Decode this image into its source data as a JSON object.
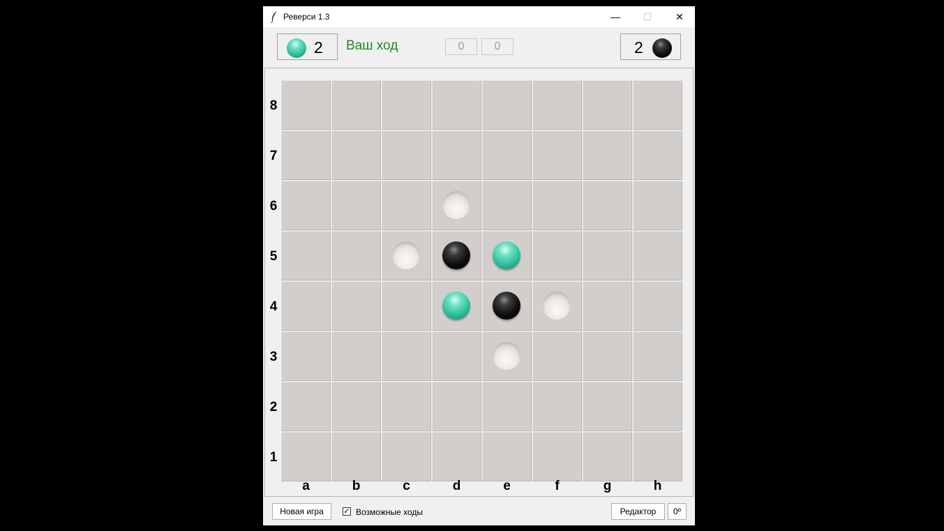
{
  "window": {
    "title": "Реверси 1.3",
    "controls": {
      "minimize": "—",
      "maximize": "☐",
      "close": "✕"
    }
  },
  "header": {
    "player_score": "2",
    "player_color": "teal",
    "turn_text": "Ваш ход",
    "counter_1": "0",
    "counter_2": "0",
    "opponent_score": "2",
    "opponent_color": "black"
  },
  "board": {
    "files": [
      "a",
      "b",
      "c",
      "d",
      "e",
      "f",
      "g",
      "h"
    ],
    "ranks": [
      "8",
      "7",
      "6",
      "5",
      "4",
      "3",
      "2",
      "1"
    ],
    "pieces": [
      {
        "square": "d5",
        "color": "black"
      },
      {
        "square": "e5",
        "color": "teal"
      },
      {
        "square": "d4",
        "color": "teal"
      },
      {
        "square": "e4",
        "color": "black"
      }
    ],
    "hints": [
      "d6",
      "c5",
      "f4",
      "e3"
    ]
  },
  "footer": {
    "new_game_label": "Новая игра",
    "possible_moves_label": "Возможные ходы",
    "possible_moves_checked": true,
    "check_mark": "✓",
    "editor_label": "Редактор",
    "rotation_label": "0º"
  },
  "colors": {
    "turn_text": "#1e8a1e",
    "cell": "#d2cecc",
    "teal_piece": "#2cbf9c",
    "black_piece": "#0c0c0c"
  }
}
